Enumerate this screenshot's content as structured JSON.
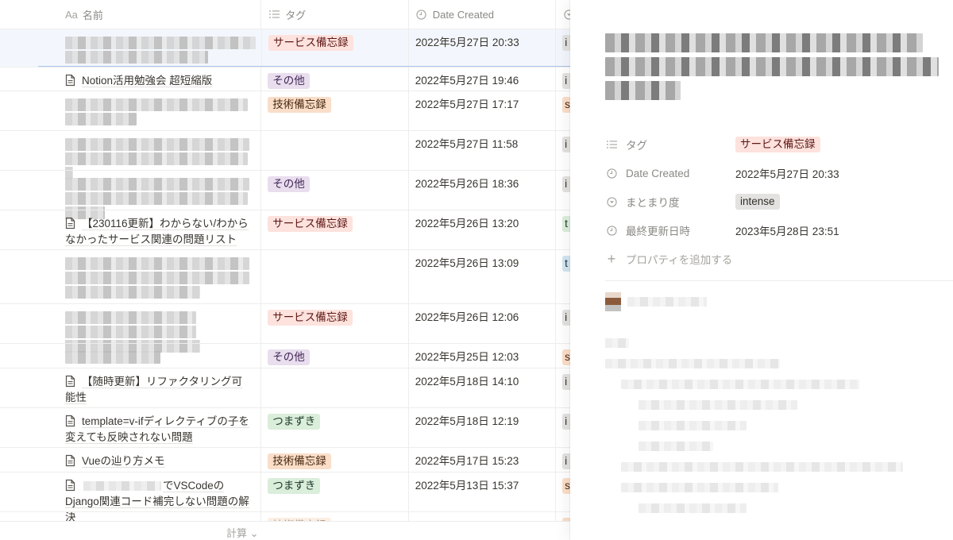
{
  "table": {
    "columns": [
      {
        "icon": "text-type-icon",
        "icon_glyph": "Aa",
        "label": "名前"
      },
      {
        "icon": "list-icon",
        "icon_glyph": "☰",
        "label": "タグ"
      },
      {
        "icon": "clock-icon",
        "icon_glyph": "◷",
        "label": "Date Created"
      },
      {
        "icon": "select-icon",
        "icon_glyph": "◉",
        "label": ""
      }
    ],
    "rows": [
      {
        "name": "",
        "redacted": true,
        "tag": "サービス備忘録",
        "tag_color": "red",
        "date": "2022年5月27日 20:33",
        "level": "i",
        "level_color": "gray",
        "selected": true
      },
      {
        "name": "Notion活用勉強会 超短縮版",
        "redacted": false,
        "tag": "その他",
        "tag_color": "purple",
        "date": "2022年5月27日 19:46",
        "level": "i",
        "level_color": "gray"
      },
      {
        "name": "",
        "redacted": true,
        "tag": "技術備忘録",
        "tag_color": "orange",
        "date": "2022年5月27日 17:17",
        "level": "s",
        "level_color": "orange"
      },
      {
        "name": "",
        "redacted": true,
        "tag": "",
        "tag_color": "",
        "date": "2022年5月27日 11:58",
        "level": "i",
        "level_color": "gray"
      },
      {
        "name": "",
        "redacted": true,
        "tag": "その他",
        "tag_color": "purple",
        "date": "2022年5月26日 18:36",
        "level": "i",
        "level_color": "gray"
      },
      {
        "name": "【230116更新】わからない/わからなかったサービス関連の問題リスト",
        "redacted": false,
        "tag": "サービス備忘録",
        "tag_color": "red",
        "date": "2022年5月26日 13:20",
        "level": "t",
        "level_color": "green"
      },
      {
        "name": "",
        "redacted": true,
        "tag": "",
        "tag_color": "",
        "date": "2022年5月26日 13:09",
        "level": "t",
        "level_color": "blue"
      },
      {
        "name": "",
        "redacted": true,
        "tag": "サービス備忘録",
        "tag_color": "red",
        "date": "2022年5月26日 12:06",
        "level": "i",
        "level_color": "gray"
      },
      {
        "name": "",
        "redacted": true,
        "tag": "その他",
        "tag_color": "purple",
        "date": "2022年5月25日 12:03",
        "level": "s",
        "level_color": "orange"
      },
      {
        "name": "【随時更新】リファクタリング可能性",
        "redacted": false,
        "tag": "",
        "tag_color": "",
        "date": "2022年5月18日 14:10",
        "level": "i",
        "level_color": "gray"
      },
      {
        "name": "template=v-ifディレクティブの子を変えても反映されない問題",
        "redacted": false,
        "tag": "つまずき",
        "tag_color": "green",
        "date": "2022年5月18日 12:19",
        "level": "i",
        "level_color": "gray"
      },
      {
        "name": "Vueの辿り方メモ",
        "redacted": false,
        "tag": "技術備忘録",
        "tag_color": "orange",
        "date": "2022年5月17日 15:23",
        "level": "i",
        "level_color": "gray"
      },
      {
        "name": "でVSCodeのDjango関連コード補完しない問題の解決",
        "redacted": false,
        "partial_redacted": true,
        "tag": "つまずき",
        "tag_color": "green",
        "date": "2022年5月13日 15:37",
        "level": "s",
        "level_color": "orange"
      },
      {
        "name": "",
        "redacted": true,
        "tag": "技術備忘録",
        "tag_color": "orange",
        "date": "",
        "level": "",
        "level_color": "orange"
      }
    ],
    "footer": {
      "calc_label": "計算 ⌄"
    }
  },
  "panel": {
    "title": "",
    "properties": [
      {
        "icon": "list-icon",
        "icon_glyph": "☰",
        "label": "タグ",
        "value": "サービス備忘録",
        "type": "pill",
        "color": "red"
      },
      {
        "icon": "clock-icon",
        "icon_glyph": "◷",
        "label": "Date Created",
        "value": "2022年5月27日 20:33",
        "type": "text"
      },
      {
        "icon": "select-icon",
        "icon_glyph": "◉",
        "label": "まとまり度",
        "value": "intense",
        "type": "pill",
        "color": "gray"
      },
      {
        "icon": "clock-icon",
        "icon_glyph": "◷",
        "label": "最終更新日時",
        "value": "2023年5月28日 23:51",
        "type": "text"
      }
    ],
    "add_property_label": "プロパティを追加する"
  }
}
